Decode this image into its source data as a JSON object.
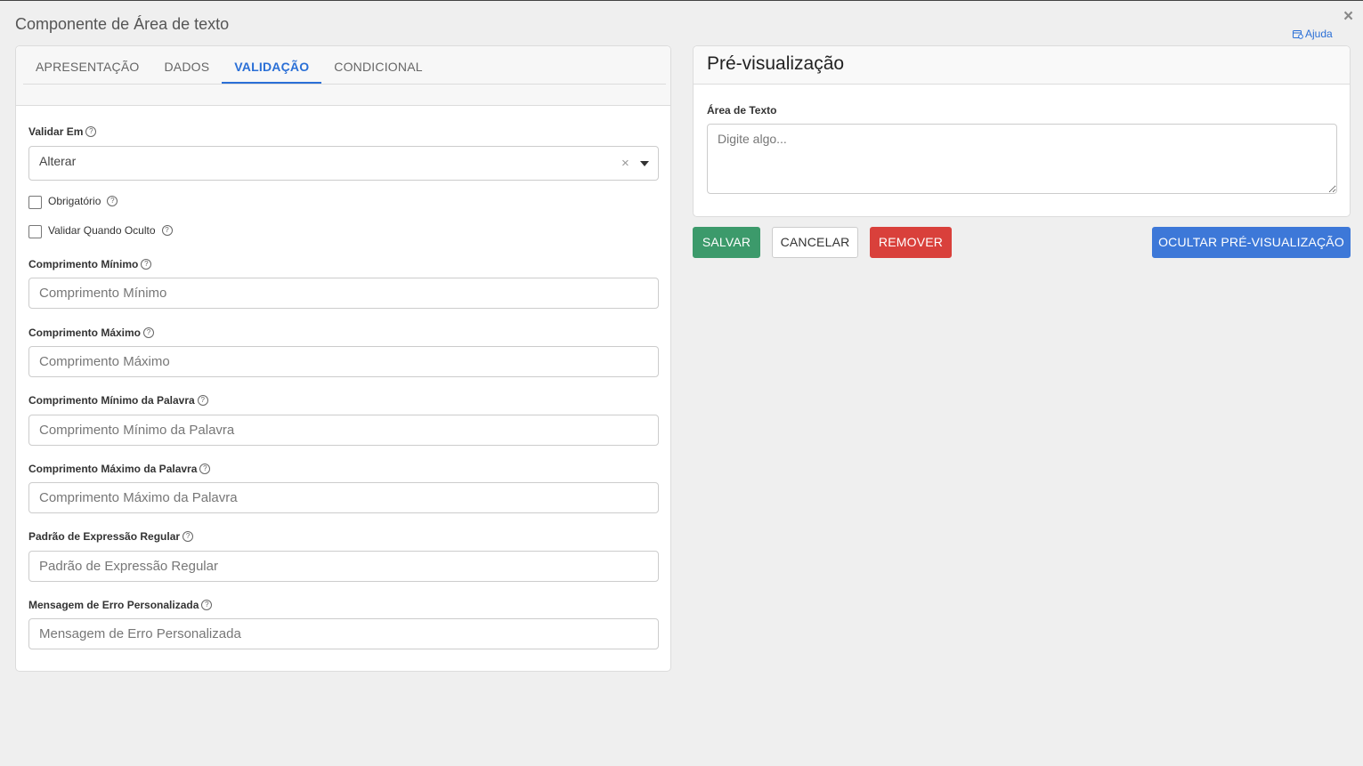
{
  "dialog": {
    "title": "Componente de Área de texto",
    "close_glyph": "×",
    "help_label": "Ajuda"
  },
  "tabs": [
    {
      "label": "APRESENTAÇÃO",
      "active": false
    },
    {
      "label": "DADOS",
      "active": false
    },
    {
      "label": "VALIDAÇÃO",
      "active": true
    },
    {
      "label": "CONDICIONAL",
      "active": false
    }
  ],
  "validation": {
    "validate_on": {
      "label": "Validar Em",
      "value": "Alterar",
      "clear_glyph": "×"
    },
    "required": {
      "label": "Obrigatório",
      "checked": false
    },
    "validate_when_hidden": {
      "label": "Validar Quando Oculto",
      "checked": false
    },
    "fields": [
      {
        "label": "Comprimento Mínimo",
        "placeholder": "Comprimento Mínimo",
        "value": ""
      },
      {
        "label": "Comprimento Máximo",
        "placeholder": "Comprimento Máximo",
        "value": ""
      },
      {
        "label": "Comprimento Mínimo da Palavra",
        "placeholder": "Comprimento Mínimo da Palavra",
        "value": ""
      },
      {
        "label": "Comprimento Máximo da Palavra",
        "placeholder": "Comprimento Máximo da Palavra",
        "value": ""
      },
      {
        "label": "Padrão de Expressão Regular",
        "placeholder": "Padrão de Expressão Regular",
        "value": ""
      },
      {
        "label": "Mensagem de Erro Personalizada",
        "placeholder": "Mensagem de Erro Personalizada",
        "value": ""
      }
    ],
    "help_glyph": "?"
  },
  "preview": {
    "title": "Pré-visualização",
    "field_label": "Área de Texto",
    "placeholder": "Digite algo..."
  },
  "actions": {
    "save": "SALVAR",
    "cancel": "CANCELAR",
    "remove": "REMOVER",
    "hide_preview": "OCULTAR PRÉ-VISUALIZAÇÃO"
  },
  "colors": {
    "accent": "#2a6fd6",
    "save": "#3c9a6b",
    "remove": "#d9403b",
    "hide_preview": "#3d78d8",
    "background": "#efefef"
  },
  "icons": {
    "close": "close-icon",
    "help_link": "help-book-icon",
    "field_help": "question-circle-icon",
    "dropdown": "caret-down-icon",
    "clear": "clear-icon"
  }
}
